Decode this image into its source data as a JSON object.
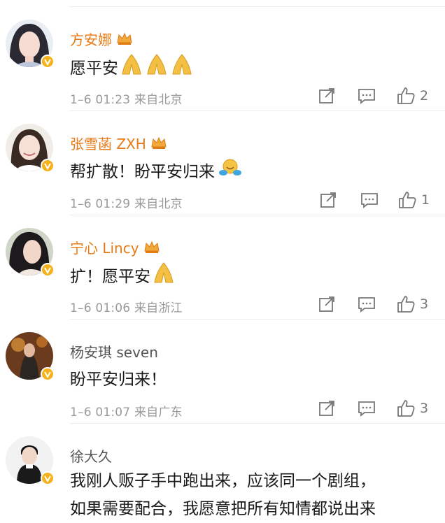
{
  "comments": [
    {
      "name": "方安娜",
      "text": "愿平安",
      "emoji_count": 3,
      "date": "1–6 01:23",
      "location": "来自北京",
      "likes": "2",
      "vip": true
    },
    {
      "name": "张雪菡 ZXH",
      "text": "帮扩散！盼平安归来",
      "emoji_count": 0,
      "date": "1–6 01:29",
      "location": "来自北京",
      "likes": "1",
      "vip": true
    },
    {
      "name": "宁心 Lincy",
      "text": "扩！愿平安",
      "emoji_count": 1,
      "date": "1–6 01:06",
      "location": "来自浙江",
      "likes": "3",
      "vip": true
    },
    {
      "name": "杨安琪 seven",
      "text": "盼平安归来！",
      "emoji_count": 0,
      "date": "1–6 01:07",
      "location": "来自广东",
      "likes": "3",
      "vip": false
    },
    {
      "name": "徐大久",
      "text_line1": "我刚人贩子手中跑出来，应该同一个剧组，",
      "text_line2": "如果需要配合，我愿意把所有知情都说出来",
      "vip": false
    }
  ],
  "icons": {
    "share": "share-icon",
    "comment": "comment-icon",
    "like": "thumbs-up-icon",
    "crown": "crown-icon",
    "verified": "verified-badge-icon",
    "pray": "praying-hands-emoji",
    "hug": "hugging-emoji"
  },
  "colors": {
    "vip_name": "#e97a13",
    "plain_name": "#555555",
    "meta": "#9a9a9a",
    "badge": "#f5b21a"
  }
}
